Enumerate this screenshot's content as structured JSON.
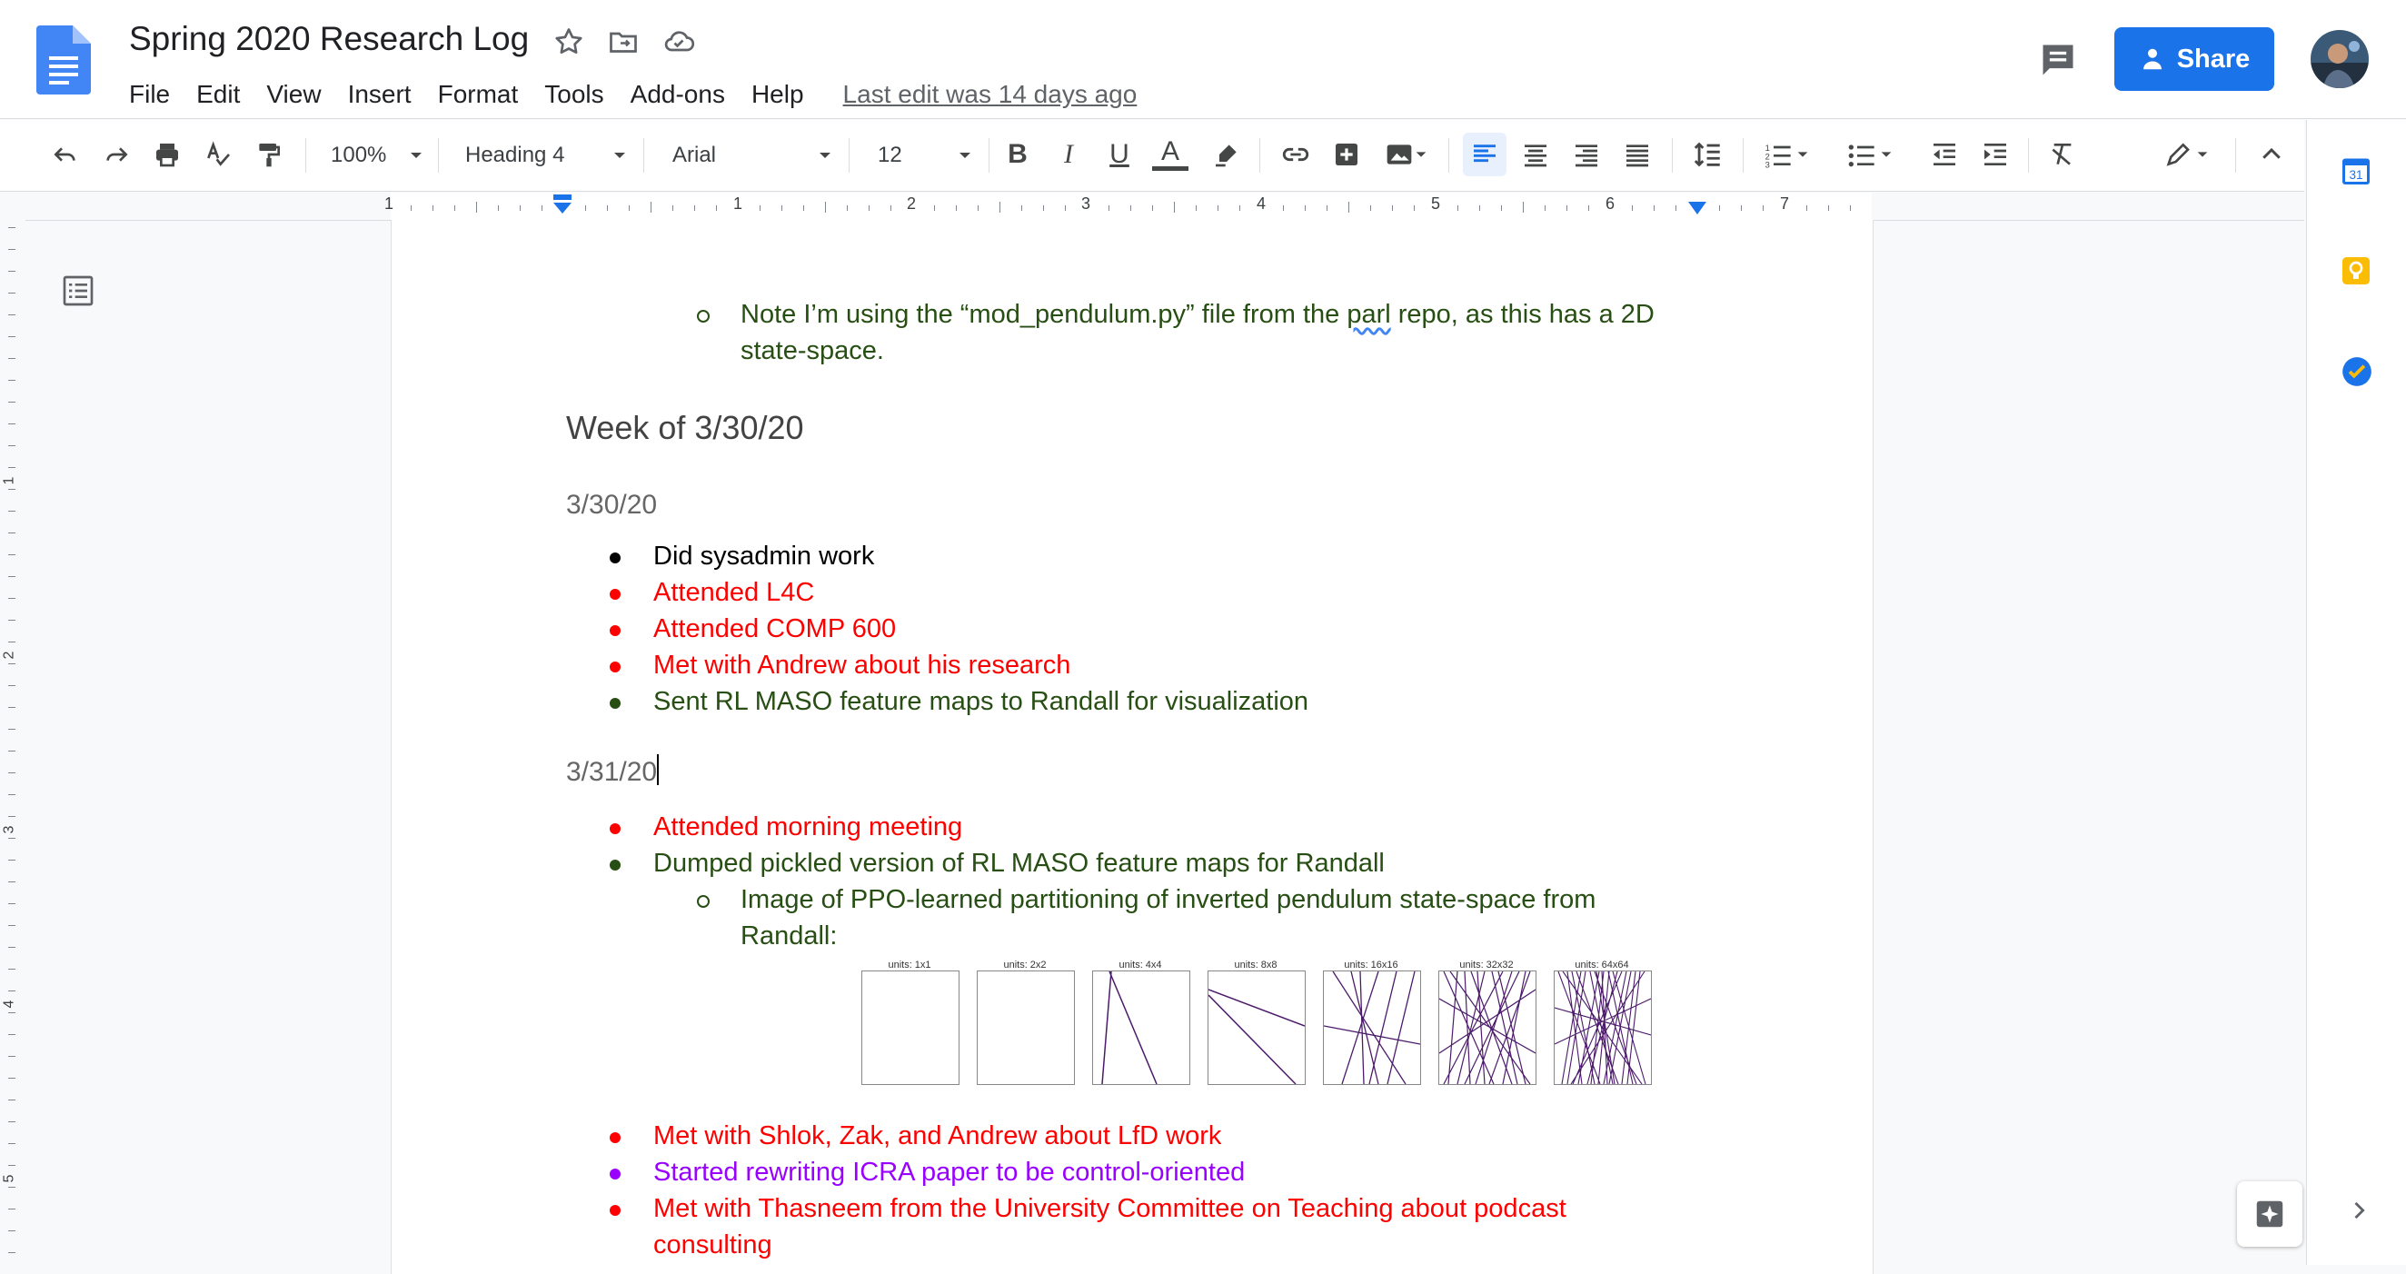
{
  "app": {
    "doc_title": "Spring 2020 Research Log",
    "last_edit": "Last edit was 14 days ago",
    "menu": [
      "File",
      "Edit",
      "View",
      "Insert",
      "Format",
      "Tools",
      "Add-ons",
      "Help"
    ],
    "share_label": "Share",
    "colors": {
      "accent": "#1a73e8",
      "doc_icon": "#4285f4"
    }
  },
  "toolbar": {
    "zoom": "100%",
    "style": "Heading 4",
    "font": "Arial",
    "font_size": "12",
    "icons": [
      "undo-icon",
      "redo-icon",
      "print-icon",
      "spellcheck-icon",
      "paint-format-icon",
      "bold-icon",
      "italic-icon",
      "underline-icon",
      "text-color-icon",
      "highlight-icon",
      "link-icon",
      "add-comment-icon",
      "image-icon",
      "align-left-icon",
      "align-center-icon",
      "align-right-icon",
      "justify-icon",
      "line-spacing-icon",
      "numbered-list-icon",
      "bulleted-list-icon",
      "decrease-indent-icon",
      "increase-indent-icon",
      "clear-formatting-icon",
      "editing-mode-icon",
      "collapse-icon"
    ],
    "text_buttons": {
      "bold": "B",
      "italic": "I",
      "underline": "U",
      "text_color": "A"
    }
  },
  "ruler": {
    "numbers": [
      "1",
      "1",
      "2",
      "3",
      "4",
      "5",
      "6",
      "7"
    ],
    "vertical_numbers": [
      "1",
      "2",
      "3",
      "4",
      "5"
    ]
  },
  "document": {
    "top_note": {
      "line1": "Note I’m using the “mod_pendulum.py” file from the ",
      "spell_word": "parl",
      "line1_end": " repo, as this has a 2D",
      "line2": "state-space."
    },
    "week_heading": "Week of 3/30/20",
    "day1": {
      "heading": "3/30/20",
      "items": [
        {
          "text": "Did sysadmin work",
          "color": "#000000"
        },
        {
          "text": "Attended L4C",
          "color": "#ff0000"
        },
        {
          "text": "Attended COMP 600",
          "color": "#ff0000"
        },
        {
          "text": "Met with Andrew about his research",
          "color": "#ff0000"
        },
        {
          "text": "Sent RL MASO feature maps to Randall for visualization",
          "color": "#274e13"
        }
      ]
    },
    "day2": {
      "heading": "3/31/20",
      "items": [
        {
          "text": "Attended morning meeting",
          "color": "#ff0000"
        },
        {
          "text": "Dumped pickled version of RL MASO feature maps for Randall",
          "color": "#274e13"
        }
      ],
      "subitem_line1": "Image of PPO-learned partitioning of inverted pendulum state-space from",
      "subitem_line2": "Randall:",
      "image_titles": [
        "units: 1x1",
        "units: 2x2",
        "units: 4x4",
        "units: 8x8",
        "units: 16x16",
        "units: 32x32",
        "units: 64x64"
      ],
      "items_after": [
        {
          "text": "Met with Shlok, Zak, and Andrew about LfD work",
          "color": "#ff0000"
        },
        {
          "text": "Started rewriting ICRA paper to be control-oriented",
          "color": "#9900ff"
        },
        {
          "text": "Met with Thasneem from the University Committee on Teaching about podcast",
          "color": "#ff0000"
        }
      ],
      "last_line_cont": "consulting"
    }
  },
  "side_panel": [
    "calendar-icon",
    "keep-icon",
    "tasks-icon"
  ],
  "side_panel_calendar_day": "31"
}
